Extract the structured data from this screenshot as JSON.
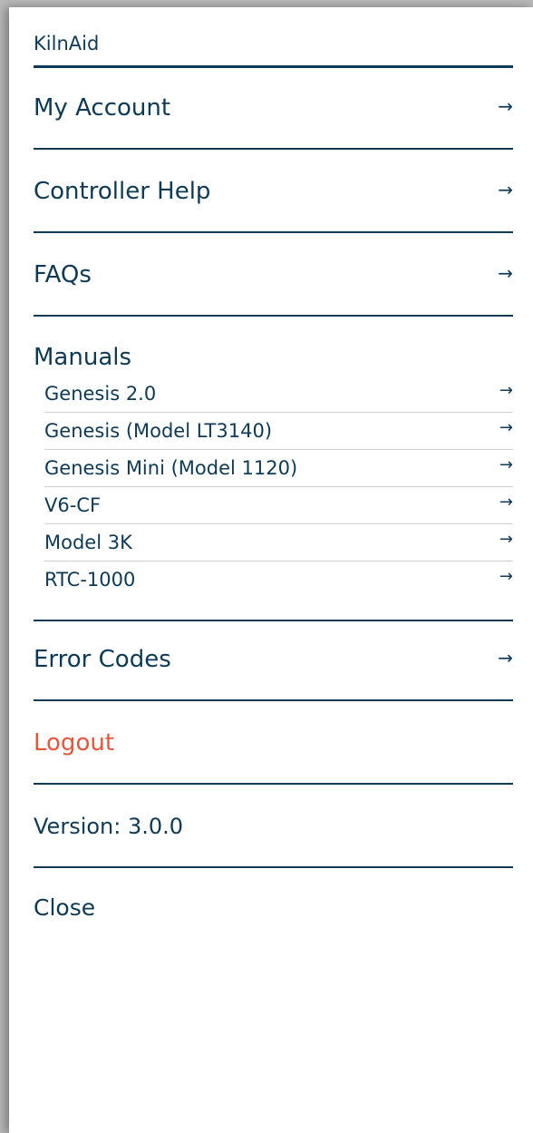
{
  "colors": {
    "primary": "#0d3a57",
    "logout": "#e8553b",
    "divider": "#cfcfcf",
    "backdrop": "#b9b9b9"
  },
  "brand": "KilnAid",
  "menu": {
    "my_account": "My Account",
    "controller_help": "Controller Help",
    "faqs": "FAQs",
    "manuals_title": "Manuals",
    "manuals": [
      "Genesis 2.0",
      "Genesis (Model LT3140)",
      "Genesis Mini (Model 1120)",
      "V6-CF",
      "Model 3K",
      "RTC-1000"
    ],
    "error_codes": "Error Codes",
    "logout": "Logout",
    "version": "Version: 3.0.0",
    "close": "Close"
  },
  "icons": {
    "arrow": "→"
  }
}
